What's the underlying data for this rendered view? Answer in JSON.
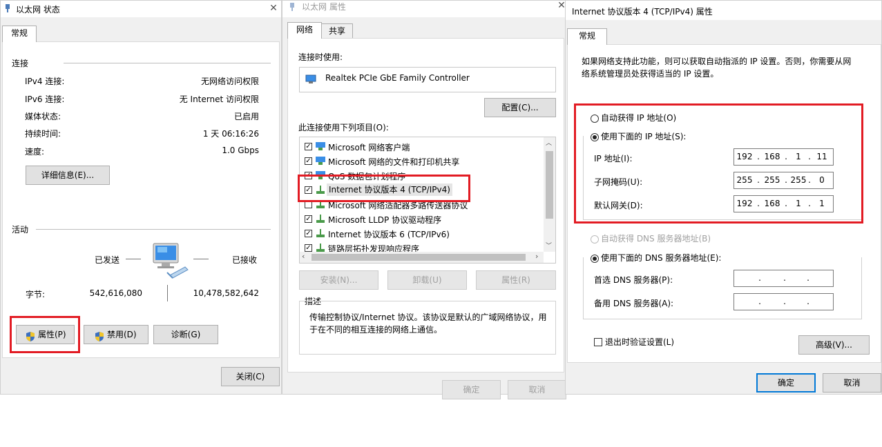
{
  "status_window": {
    "title": "以太网 状态",
    "tab_general": "常规",
    "connection_heading": "连接",
    "rows": [
      {
        "label": "IPv4 连接:",
        "value": "无网络访问权限"
      },
      {
        "label": "IPv6 连接:",
        "value": "无 Internet 访问权限"
      },
      {
        "label": "媒体状态:",
        "value": "已启用"
      },
      {
        "label": "持续时间:",
        "value": "1 天 06:16:26"
      },
      {
        "label": "速度:",
        "value": "1.0 Gbps"
      }
    ],
    "details_button": "详细信息(E)...",
    "activity_heading": "活动",
    "sent_label": "已发送",
    "received_label": "已接收",
    "bytes_label": "字节:",
    "bytes_sent": "542,616,080",
    "bytes_received": "10,478,582,642",
    "properties_button": "属性(P)",
    "disable_button": "禁用(D)",
    "diagnose_button": "诊断(G)",
    "close_button": "关闭(C)"
  },
  "props_window": {
    "title": "以太网 属性",
    "tab_network": "网络",
    "tab_sharing": "共享",
    "connect_using_label": "连接时使用:",
    "adapter_name": "Realtek PCIe GbE Family Controller",
    "configure_button": "配置(C)...",
    "items_label": "此连接使用下列项目(O):",
    "items": [
      {
        "label": "Microsoft 网络客户端",
        "checked": true
      },
      {
        "label": "Microsoft 网络的文件和打印机共享",
        "checked": true
      },
      {
        "label": "QoS 数据包计划程序",
        "checked": true
      },
      {
        "label": "Internet 协议版本 4 (TCP/IPv4)",
        "checked": true
      },
      {
        "label": "Microsoft 网络适配器多路传送器协议",
        "checked": false
      },
      {
        "label": "Microsoft LLDP 协议驱动程序",
        "checked": true
      },
      {
        "label": "Internet 协议版本 6 (TCP/IPv6)",
        "checked": true
      },
      {
        "label": "链路层拓扑发现响应程序",
        "checked": true
      }
    ],
    "install_button": "安装(N)...",
    "uninstall_button": "卸载(U)",
    "properties_button": "属性(R)",
    "description_heading": "描述",
    "description_text": "传输控制协议/Internet 协议。该协议是默认的广域网络协议，用于在不同的相互连接的网络上通信。",
    "ok_button": "确定",
    "cancel_button": "取消"
  },
  "ipv4_window": {
    "title": "Internet 协议版本 4 (TCP/IPv4) 属性",
    "tab_general": "常规",
    "intro_text": "如果网络支持此功能，则可以获取自动指派的 IP 设置。否则，你需要从网络系统管理员处获得适当的 IP 设置。",
    "auto_ip_label": "自动获得 IP 地址(O)",
    "manual_ip_label": "使用下面的 IP 地址(S):",
    "ip_label": "IP 地址(I):",
    "ip_value": [
      "192",
      "168",
      "1",
      "11"
    ],
    "mask_label": "子网掩码(U):",
    "mask_value": [
      "255",
      "255",
      "255",
      "0"
    ],
    "gateway_label": "默认网关(D):",
    "gateway_value": [
      "192",
      "168",
      "1",
      "1"
    ],
    "auto_dns_label": "自动获得 DNS 服务器地址(B)",
    "manual_dns_label": "使用下面的 DNS 服务器地址(E):",
    "preferred_dns_label": "首选 DNS 服务器(P):",
    "alternate_dns_label": "备用 DNS 服务器(A):",
    "validate_label": "退出时验证设置(L)",
    "advanced_button": "高级(V)...",
    "ok_button": "确定",
    "cancel_button": "取消"
  },
  "colors": {
    "highlight": "#e21b23",
    "accent": "#0078d7"
  }
}
